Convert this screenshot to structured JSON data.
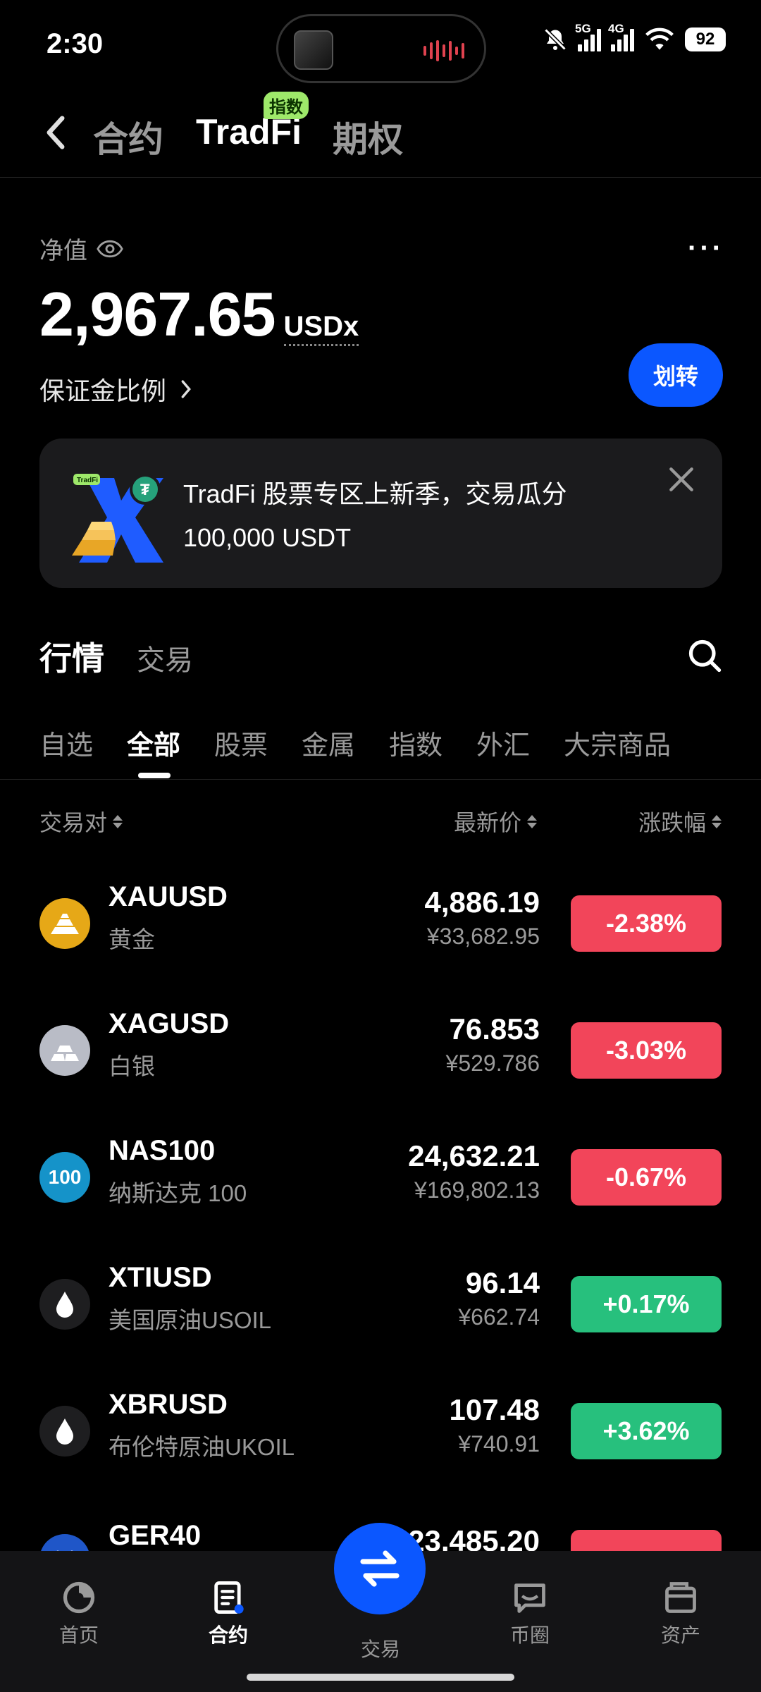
{
  "status": {
    "time": "2:30",
    "net1": "5G",
    "net2": "4G",
    "battery": "92"
  },
  "header": {
    "tabs": [
      {
        "label": "合约"
      },
      {
        "label": "TradFi",
        "badge": "指数"
      },
      {
        "label": "期权"
      }
    ]
  },
  "account": {
    "equity_label": "净值",
    "equity_value": "2,967.65",
    "equity_unit": "USDx",
    "margin_ratio_label": "保证金比例",
    "transfer_label": "划转",
    "more": "···"
  },
  "banner": {
    "line1": "TradFi 股票专区上新季，交易瓜分",
    "line2": "100,000 USDT",
    "art_tag": "TradFi"
  },
  "market": {
    "tabs": [
      "行情",
      "交易"
    ],
    "categories": [
      "自选",
      "全部",
      "股票",
      "金属",
      "指数",
      "外汇",
      "大宗商品"
    ],
    "active_category": "全部",
    "columns": {
      "pair": "交易对",
      "price": "最新价",
      "change": "涨跌幅"
    },
    "rows": [
      {
        "symbol": "XAUUSD",
        "name": "黄金",
        "price": "4,886.19",
        "cny": "¥33,682.95",
        "change": "-2.38%",
        "dir": "down",
        "icon": "gold-bars-icon",
        "icon_color": "#e6a817"
      },
      {
        "symbol": "XAGUSD",
        "name": "白银",
        "price": "76.853",
        "cny": "¥529.786",
        "change": "-3.03%",
        "dir": "down",
        "icon": "silver-bars-icon",
        "icon_color": "#b9bcc6"
      },
      {
        "symbol": "NAS100",
        "name": "纳斯达克 100",
        "price": "24,632.21",
        "cny": "¥169,802.13",
        "change": "-0.67%",
        "dir": "down",
        "icon": "nas100-icon",
        "icon_color": "#1593c9",
        "icon_text": "100"
      },
      {
        "symbol": "XTIUSD",
        "name": "美国原油USOIL",
        "price": "96.14",
        "cny": "¥662.74",
        "change": "+0.17%",
        "dir": "up",
        "icon": "oil-drop-icon",
        "icon_color": "#1e1e20"
      },
      {
        "symbol": "XBRUSD",
        "name": "布伦特原油UKOIL",
        "price": "107.48",
        "cny": "¥740.91",
        "change": "+3.62%",
        "dir": "up",
        "icon": "oil-drop-icon",
        "icon_color": "#1e1e20"
      },
      {
        "symbol": "GER40",
        "name": "",
        "price": "23,485.20",
        "cny": "",
        "change": "",
        "dir": "down",
        "icon": "ger40-icon",
        "icon_color": "#1f56c8"
      }
    ]
  },
  "nav": {
    "items": [
      {
        "label": "首页"
      },
      {
        "label": "合约"
      },
      {
        "label": "交易"
      },
      {
        "label": "币圈"
      },
      {
        "label": "资产"
      }
    ]
  }
}
